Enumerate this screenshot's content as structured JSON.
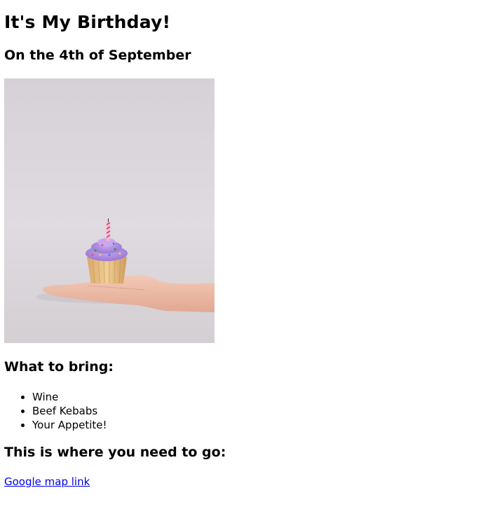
{
  "heading": "It's My Birthday!",
  "subheading": "On the 4th of September",
  "image": {
    "subject": "hand-holding-cupcake-with-candle"
  },
  "bring": {
    "title": "What to bring:",
    "items": [
      "Wine",
      "Beef Kebabs",
      "Your Appetite!"
    ]
  },
  "where": {
    "title": "This is where you need to go:",
    "link_text": "Google map link"
  },
  "colors": {
    "link": "#0000ee",
    "text": "#000000",
    "background": "#ffffff"
  }
}
